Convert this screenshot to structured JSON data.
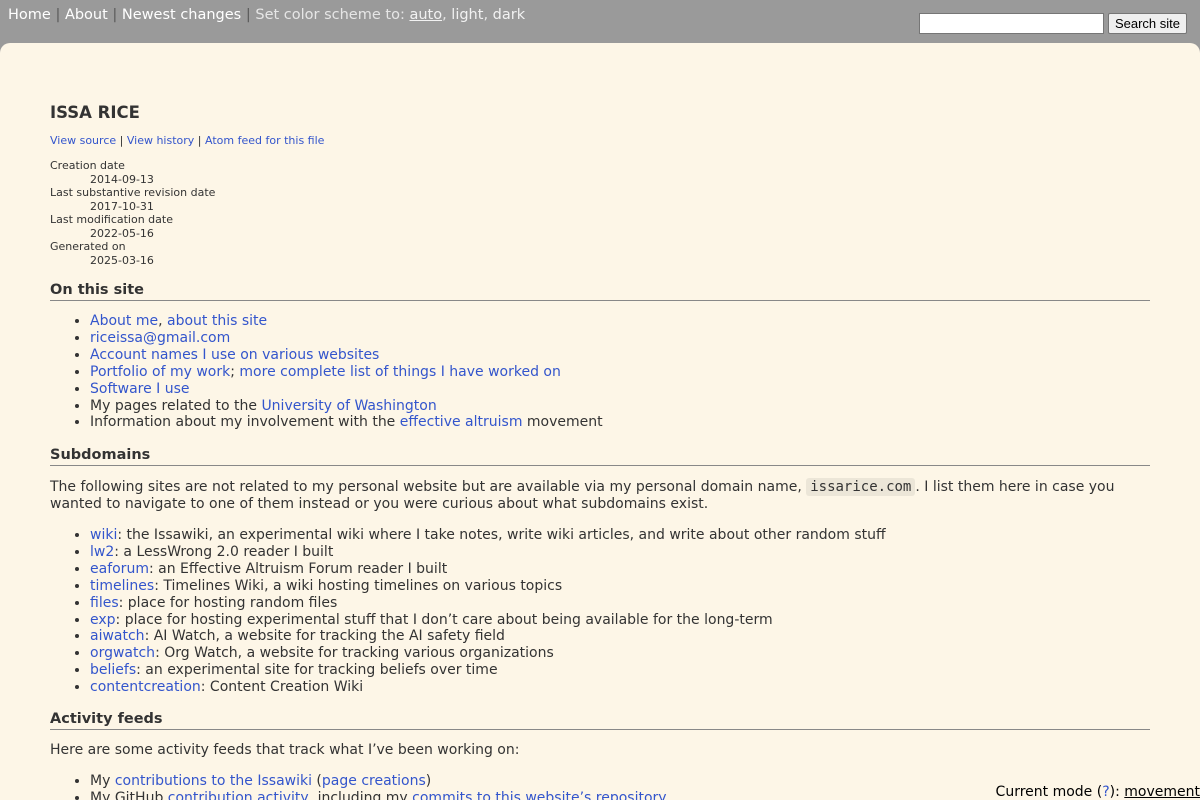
{
  "topnav": {
    "home": "Home",
    "about": "About",
    "newest": "Newest changes",
    "sep": "|",
    "scheme_label": "Set color scheme to:",
    "scheme_auto": "auto",
    "scheme_light": "light",
    "scheme_dark": "dark"
  },
  "search": {
    "placeholder": "",
    "button": "Search site"
  },
  "page": {
    "title": "ISSA RICE",
    "source_links": [
      "View source",
      "View history",
      "Atom feed for this file"
    ],
    "meta": [
      {
        "label": "Creation date",
        "value": "2014-09-13"
      },
      {
        "label": "Last substantive revision date",
        "value": "2017-10-31"
      },
      {
        "label": "Last modification date",
        "value": "2022-05-16"
      },
      {
        "label": "Generated on",
        "value": "2025-03-16"
      }
    ]
  },
  "on_this_site": {
    "heading": "On this site",
    "items": {
      "about_me": "About me",
      "about_site": "about this site",
      "email": "riceissa@gmail.com",
      "accounts": "Account names I use on various websites",
      "portfolio": "Portfolio of my work",
      "worklist": "more complete list of things I have worked on",
      "software": "Software I use",
      "uw_prefix": "My pages related to the ",
      "uw_link": "University of Washington",
      "ea_prefix": "Information about my involvement with the ",
      "ea_link": "effective altruism",
      "ea_suffix": " movement"
    }
  },
  "subdomains": {
    "heading": "Subdomains",
    "intro_before": "The following sites are not related to my personal website but are available via my personal domain name, ",
    "domain": "issarice.com",
    "intro_after": ". I list them here in case you wanted to navigate to one of them instead or you were curious about what subdomains exist.",
    "items": [
      {
        "name": "wiki",
        "desc": ": the Issawiki, an experimental wiki where I take notes, write wiki articles, and write about other random stuff"
      },
      {
        "name": "lw2",
        "desc": ": a LessWrong 2.0 reader I built"
      },
      {
        "name": "eaforum",
        "desc": ": an Effective Altruism Forum reader I built"
      },
      {
        "name": "timelines",
        "desc": ": Timelines Wiki, a wiki hosting timelines on various topics"
      },
      {
        "name": "files",
        "desc": ": place for hosting random files"
      },
      {
        "name": "exp",
        "desc": ": place for hosting experimental stuff that I don’t care about being available for the long-term"
      },
      {
        "name": "aiwatch",
        "desc": ": AI Watch, a website for tracking the AI safety field"
      },
      {
        "name": "orgwatch",
        "desc": ": Org Watch, a website for tracking various organizations"
      },
      {
        "name": "beliefs",
        "desc": ": an experimental site for tracking beliefs over time"
      },
      {
        "name": "contentcreation",
        "desc": ": Content Creation Wiki"
      }
    ]
  },
  "activity": {
    "heading": "Activity feeds",
    "intro": "Here are some activity feeds that track what I’ve been working on:",
    "item1_prefix": "My ",
    "item1_link": "contributions to the Issawiki",
    "item1_open": " (",
    "item1_link2": "page creations",
    "item1_close": ")",
    "item2_prefix": "My GitHub ",
    "item2_link": "contribution activity",
    "item2_mid": ", including my ",
    "item2_link2": "commits to this website’s repository"
  },
  "modebar": {
    "label": "Current mode (",
    "help": "?",
    "after": "): ",
    "mode": "movement"
  }
}
